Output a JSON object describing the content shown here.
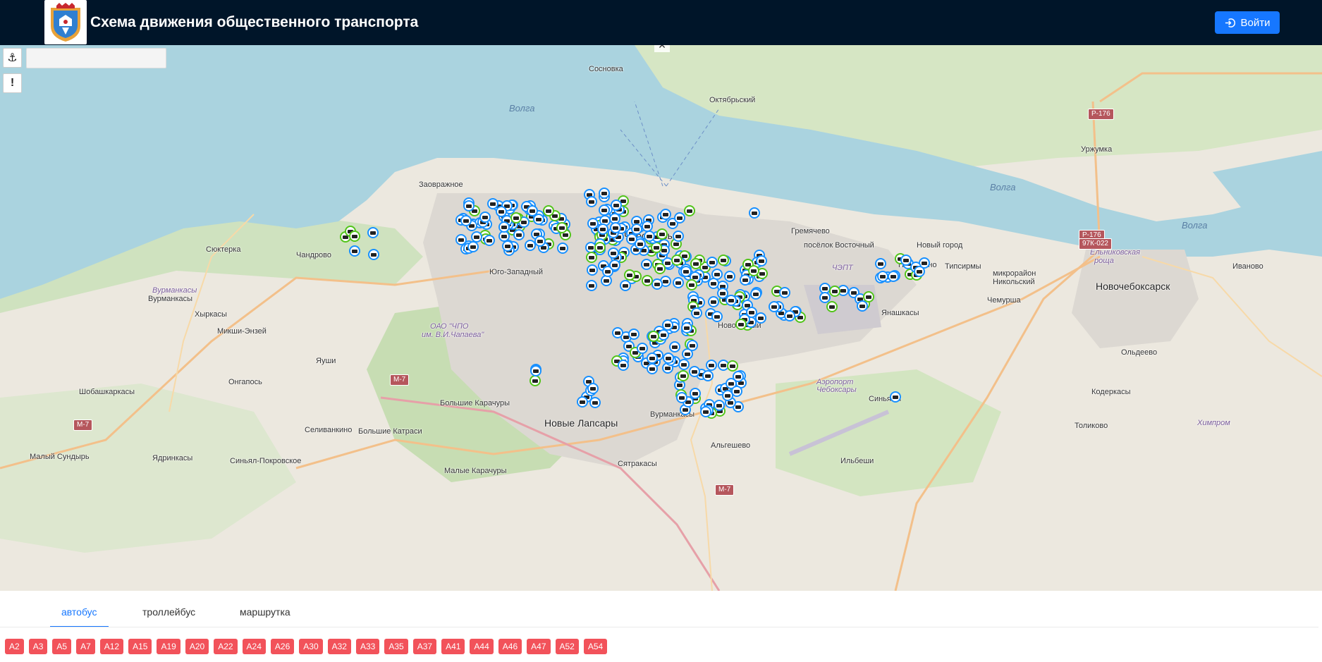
{
  "header": {
    "title": "Схема движения общественного транспорта",
    "login_label": "Войти",
    "login_icon": "login-icon",
    "logo_icon": "coat-of-arms-icon"
  },
  "map": {
    "controls": {
      "locate_icon": "anchor-icon",
      "info_label": "!",
      "search_value": "",
      "close_label": "×"
    },
    "places": [
      {
        "name": "Сосновка",
        "cls": ""
      },
      {
        "name": "Октябрьский",
        "cls": ""
      },
      {
        "name": "Волга",
        "cls": "water"
      },
      {
        "name": "Волга",
        "cls": "water"
      },
      {
        "name": "Волга",
        "cls": "water"
      },
      {
        "name": "Уржумка",
        "cls": ""
      },
      {
        "name": "Заовражное",
        "cls": ""
      },
      {
        "name": "Сюктерка",
        "cls": ""
      },
      {
        "name": "Чандрово",
        "cls": ""
      },
      {
        "name": "Гремячево",
        "cls": ""
      },
      {
        "name": "Пихтулино",
        "cls": ""
      },
      {
        "name": "Типсирмы",
        "cls": ""
      },
      {
        "name": "микрорайон",
        "cls": ""
      },
      {
        "name": "Никольский",
        "cls": ""
      },
      {
        "name": "Новочебоксарск",
        "cls": "big"
      },
      {
        "name": "Иваново",
        "cls": ""
      },
      {
        "name": "Ельниковская",
        "cls": "purple"
      },
      {
        "name": "роща",
        "cls": "purple"
      },
      {
        "name": "ЧЭПТ",
        "cls": "purple"
      },
      {
        "name": "Вурманкасы",
        "cls": "purple"
      },
      {
        "name": "Вурманкасы",
        "cls": ""
      },
      {
        "name": "Хыркасы",
        "cls": ""
      },
      {
        "name": "Микши-Энзей",
        "cls": ""
      },
      {
        "name": "ОАО \"ЧПО",
        "cls": "purple"
      },
      {
        "name": "им. В.И.Чапаева\"",
        "cls": "purple"
      },
      {
        "name": "Янашкасы",
        "cls": ""
      },
      {
        "name": "Чемурша",
        "cls": ""
      },
      {
        "name": "Яуши",
        "cls": ""
      },
      {
        "name": "Онгапось",
        "cls": ""
      },
      {
        "name": "Шобашкаркасы",
        "cls": ""
      },
      {
        "name": "Аэропорт",
        "cls": "purple"
      },
      {
        "name": "Чебоксары",
        "cls": "purple"
      },
      {
        "name": "Синьялы",
        "cls": ""
      },
      {
        "name": "Ольдеево",
        "cls": ""
      },
      {
        "name": "Кодеркасы",
        "cls": ""
      },
      {
        "name": "Большие Карачуры",
        "cls": ""
      },
      {
        "name": "Вурманкасы",
        "cls": ""
      },
      {
        "name": "Новые Лапсары",
        "cls": "big"
      },
      {
        "name": "Селиванкино",
        "cls": ""
      },
      {
        "name": "Большие Катраси",
        "cls": ""
      },
      {
        "name": "Толиково",
        "cls": ""
      },
      {
        "name": "Химпром",
        "cls": "purple"
      },
      {
        "name": "Альгешево",
        "cls": ""
      },
      {
        "name": "Малый Сундырь",
        "cls": ""
      },
      {
        "name": "Ядринкасы",
        "cls": ""
      },
      {
        "name": "Синьял-Покровское",
        "cls": ""
      },
      {
        "name": "Сятракасы",
        "cls": ""
      },
      {
        "name": "Ильбеши",
        "cls": ""
      },
      {
        "name": "Малые Карачуры",
        "cls": ""
      },
      {
        "name": "Чебоксары",
        "cls": "big"
      },
      {
        "name": "Новый город",
        "cls": ""
      },
      {
        "name": "посёлок Восточный",
        "cls": ""
      },
      {
        "name": "Юго-Западный",
        "cls": ""
      },
      {
        "name": "Новоюжный",
        "cls": ""
      }
    ],
    "shields": [
      "Р-176",
      "Р-176",
      "97К-022",
      "М-7",
      "М-7",
      "М-7"
    ]
  },
  "tabs": [
    {
      "label": "автобус",
      "active": true
    },
    {
      "label": "троллейбус",
      "active": false
    },
    {
      "label": "маршрутка",
      "active": false
    }
  ],
  "routes": [
    "А2",
    "А3",
    "А5",
    "А7",
    "А12",
    "А15",
    "А19",
    "А20",
    "А22",
    "А24",
    "А26",
    "А30",
    "А32",
    "А33",
    "А35",
    "А37",
    "А41",
    "А44",
    "А46",
    "А47",
    "А52",
    "А54"
  ],
  "colors": {
    "header_bg": "#001529",
    "accent": "#1677ff",
    "route_badge": "#f2525a",
    "vehicle_bus": "#1890ff",
    "vehicle_trolley": "#52c41a"
  }
}
